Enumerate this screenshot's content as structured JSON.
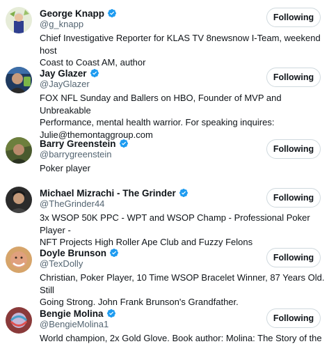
{
  "follow_list": {
    "button_label": "Following",
    "brand_colors": {
      "verified": "#1d9bf0",
      "text_primary": "#0f1419",
      "text_secondary": "#536471",
      "button_border": "#cfd9de"
    },
    "users": [
      {
        "name": "George Knapp",
        "handle": "@g_knapp",
        "verified": true,
        "avatar_icon": "george-knapp-avatar",
        "bio_lines": [
          "Chief Investigative Reporter for KLAS TV 8newsnow I-Team, weekend host",
          "Coast to Coast AM, author"
        ]
      },
      {
        "name": "Jay Glazer",
        "handle": "@JayGlazer",
        "verified": true,
        "avatar_icon": "jay-glazer-avatar",
        "bio_lines": [
          "FOX NFL Sunday and Ballers on HBO, Founder of MVP and Unbreakable",
          "Performance, mental health warrior. For speaking inquires:",
          "Julie@themontaggroup.com"
        ]
      },
      {
        "name": "Barry Greenstein",
        "handle": "@barrygreenstein",
        "verified": true,
        "avatar_icon": "barry-greenstein-avatar",
        "bio_lines": [
          "Poker player"
        ]
      },
      {
        "name": "Michael Mizrachi - The Grinder",
        "handle": "@TheGrinder44",
        "verified": true,
        "avatar_icon": "michael-mizrachi-avatar",
        "bio_lines": [
          "3x WSOP 50K PPC - WPT and WSOP Champ - Professional Poker Player -",
          "NFT Projects High Roller Ape Club and Fuzzy Felons"
        ]
      },
      {
        "name": "Doyle Brunson",
        "handle": "@TexDolly",
        "verified": true,
        "avatar_icon": "doyle-brunson-avatar",
        "bio_lines": [
          "Christian, Poker Player, 10 Time WSOP Bracelet Winner, 87 Years Old. Still",
          "Going Strong. John Frank Brunson's Grandfather."
        ]
      },
      {
        "name": "Bengie Molina",
        "handle": "@BengieMolina1",
        "verified": true,
        "avatar_icon": "bengie-molina-avatar",
        "bio_lines": [
          "World champion, 2x Gold Glove. Book author: Molina: The Story of the"
        ]
      }
    ]
  }
}
